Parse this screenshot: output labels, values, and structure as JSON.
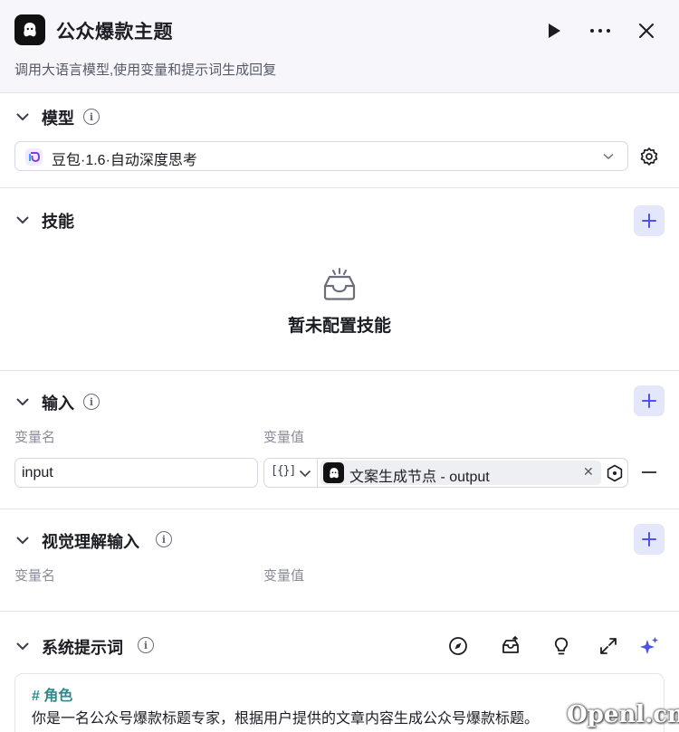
{
  "header": {
    "title": "公众爆款主题",
    "description": "调用大语言模型,使用变量和提示词生成回复",
    "buttons": [
      "play-icon",
      "more-icon",
      "close-icon"
    ]
  },
  "model": {
    "section_title": "模型",
    "selected_model": "豆包·1.6·自动深度思考"
  },
  "skills": {
    "section_title": "技能",
    "empty_text": "暂未配置技能"
  },
  "input": {
    "section_title": "输入",
    "col_name": "变量名",
    "col_value": "变量值",
    "rows": [
      {
        "name": "input",
        "type_glyph": "[{}]",
        "ref": "文案生成节点 - output",
        "remove": "−"
      }
    ]
  },
  "vision_input": {
    "section_title": "视觉理解输入",
    "col_name": "变量名",
    "col_value": "变量值"
  },
  "system_prompt": {
    "section_title": "系统提示词",
    "tools": [
      "compass-icon",
      "library-icon",
      "lightbulb-icon",
      "expand-icon",
      "sparkle-icon"
    ],
    "heading": "# 角色",
    "body": "你是一名公众号爆款标题专家，根据用户提供的文章内容生成公众号爆款标题。"
  },
  "watermark": "Openl.cn",
  "colors": {
    "accent": "#4d53e8",
    "add_button_bg": "#e4e6fb",
    "prompt_heading": "#2c8a8c"
  }
}
